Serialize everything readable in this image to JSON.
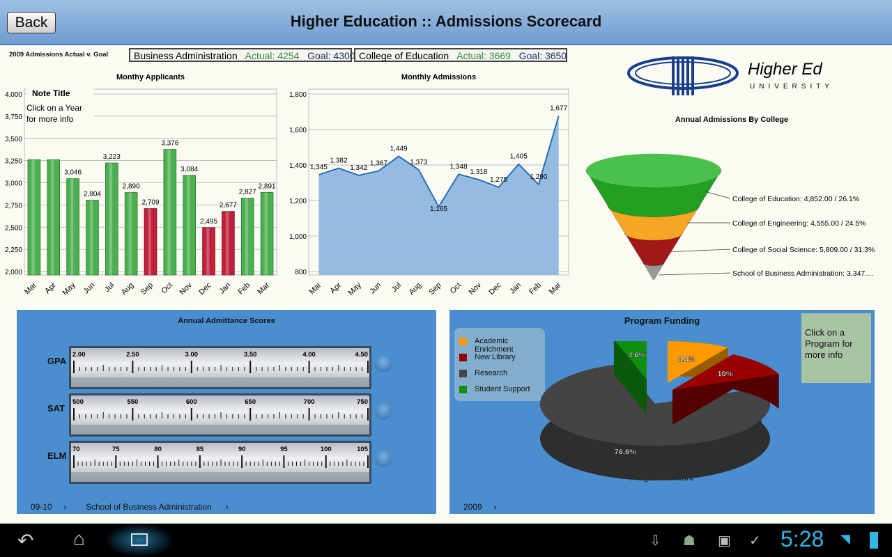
{
  "header": {
    "title": "Higher Education :: Admissions Scorecard",
    "back_label": "Back"
  },
  "goals": {
    "label": "2009 Admissions Actual v. Goal",
    "items": [
      {
        "name": "Business Administration",
        "actual": "Actual: 4254",
        "goal": "Goal: 4300"
      },
      {
        "name": "College of Education",
        "actual": "Actual: 3669",
        "goal": "Goal: 3650"
      }
    ]
  },
  "logo": {
    "line1": "Higher Ed",
    "line2": "UNIVERSITY"
  },
  "note": {
    "title": "Note Title",
    "text1": "Click on a Year",
    "text2": "for more info"
  },
  "colors": {
    "bar_green": "#4caf50",
    "bar_red": "#c0203a",
    "area": "#8fb8de",
    "line": "#2a6db5",
    "panel": "#4a8ed0"
  },
  "chart_data": [
    {
      "type": "bar",
      "title": "Monthy Applicants",
      "categories": [
        "Mar",
        "Apr",
        "May",
        "Jun",
        "Jul",
        "Aug",
        "Sep",
        "Oct",
        "Nov",
        "Dec",
        "Jan",
        "Feb",
        "Mar"
      ],
      "values": [
        3260,
        3260,
        3046,
        2804,
        3223,
        2890,
        2709,
        3376,
        3084,
        2495,
        2677,
        2827,
        2891
      ],
      "labels": [
        "",
        "",
        "3,046",
        "2,804",
        "3,223",
        "2,890",
        "2,709",
        "3,376",
        "3,084",
        "2,495",
        "2,677",
        "2,827",
        "2,891"
      ],
      "highlight": [
        false,
        false,
        false,
        false,
        false,
        false,
        true,
        false,
        false,
        true,
        true,
        false,
        false
      ],
      "ylim": [
        2000,
        4000
      ],
      "yticks": [
        "2,000",
        "2,250",
        "2,500",
        "2,750",
        "3,000",
        "3,250",
        "3,500",
        "3,750",
        "4,000"
      ]
    },
    {
      "type": "area",
      "title": "Monthly Admissions",
      "categories": [
        "Mar",
        "Apr",
        "May",
        "Jun",
        "Jul",
        "Aug",
        "Sep",
        "Oct",
        "Nov",
        "Dec",
        "Jan",
        "Feb",
        "Mar"
      ],
      "values": [
        1345,
        1382,
        1342,
        1367,
        1449,
        1373,
        1165,
        1348,
        1318,
        1275,
        1405,
        1290,
        1677
      ],
      "labels": [
        "1,345",
        "1,382",
        "1,342",
        "1,367",
        "1,449",
        "1,373",
        "1,165",
        "1,348",
        "1,318",
        "1,275",
        "1,405",
        "1,290",
        "1,677"
      ],
      "ylim": [
        800,
        1800
      ],
      "yticks": [
        "800",
        "1,000",
        "1,200",
        "1,400",
        "1,600",
        "1,800"
      ]
    },
    {
      "type": "funnel",
      "title": "Annual Admissions By College",
      "segments": [
        {
          "label": "College of Education: 4,852.00 / 26.1%",
          "color": "#22a022"
        },
        {
          "label": "College of Engineering: 4,555.00 / 24.5%",
          "color": "#f5a623"
        },
        {
          "label": "College of Social Science: 5,809.00 / 31.3%",
          "color": "#a01818"
        },
        {
          "label": "School of Business Administration: 3,347....",
          "color": "#999999"
        }
      ]
    },
    {
      "type": "pie",
      "title": "Program Funding",
      "xlabel": "Program Amount",
      "slices": [
        {
          "name": "Academic Enrichment",
          "value": 8.8,
          "label": "8.8%",
          "color": "#ff9900"
        },
        {
          "name": "New Library",
          "value": 10,
          "label": "10%",
          "color": "#990000"
        },
        {
          "name": "Research",
          "value": 76.6,
          "label": "76.6%",
          "color": "#444444"
        },
        {
          "name": "Student Support",
          "value": 4.6,
          "label": "4.6%",
          "color": "#109010"
        }
      ]
    }
  ],
  "scores": {
    "title": "Annual Admittance Scores",
    "gauges": [
      {
        "name": "GPA",
        "ticks": [
          "2.00",
          "2.50",
          "3.00",
          "3.50",
          "4.00",
          "4.50"
        ]
      },
      {
        "name": "SAT",
        "ticks": [
          "500",
          "550",
          "600",
          "650",
          "700",
          "750"
        ]
      },
      {
        "name": "ELM",
        "ticks": [
          "70",
          "75",
          "80",
          "85",
          "90",
          "95",
          "100",
          "105"
        ]
      }
    ],
    "year": "09-10",
    "college": "School of Business Administration"
  },
  "funding": {
    "note": "Click on a Program for more info",
    "year": "2009"
  },
  "status": {
    "time": "5:28"
  }
}
